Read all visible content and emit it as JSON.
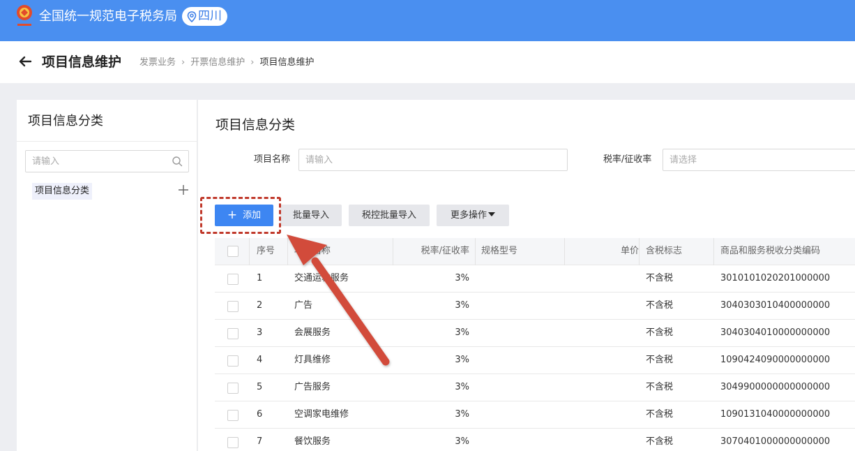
{
  "app": {
    "title": "全国统一规范电子税务局",
    "region": "四川"
  },
  "header": {
    "page_title": "项目信息维护",
    "breadcrumb": [
      "发票业务",
      "开票信息维护",
      "项目信息维护"
    ]
  },
  "left_panel": {
    "title": "项目信息分类",
    "search_placeholder": "请输入",
    "tree_node": "项目信息分类"
  },
  "main": {
    "title": "项目信息分类",
    "filters": {
      "name_label": "项目名称",
      "name_placeholder": "请输入",
      "rate_label": "税率/征收率",
      "rate_placeholder": "请选择"
    },
    "buttons": {
      "add": "添加",
      "batch_import": "批量导入",
      "taxctrl_import": "税控批量导入",
      "more": "更多操作"
    },
    "table": {
      "headers": [
        "序号",
        "项目名称",
        "税率/征收率",
        "规格型号",
        "单价",
        "含税标志",
        "商品和服务税收分类编码"
      ],
      "rows": [
        [
          "1",
          "交通运输服务",
          "3%",
          "",
          "",
          "不含税",
          "3010101020201000000"
        ],
        [
          "2",
          "广告",
          "3%",
          "",
          "",
          "不含税",
          "3040303010400000000"
        ],
        [
          "3",
          "会展服务",
          "3%",
          "",
          "",
          "不含税",
          "3040304010000000000"
        ],
        [
          "4",
          "灯具维修",
          "3%",
          "",
          "",
          "不含税",
          "1090424090000000000"
        ],
        [
          "5",
          "广告服务",
          "3%",
          "",
          "",
          "不含税",
          "3049900000000000000"
        ],
        [
          "6",
          "空调家电维修",
          "3%",
          "",
          "",
          "不含税",
          "1090131040000000000"
        ],
        [
          "7",
          "餐饮服务",
          "3%",
          "",
          "",
          "不含税",
          "3070401000000000000"
        ]
      ]
    }
  },
  "colors": {
    "brand": "#4a8ff0",
    "primary_button": "#3d86f2",
    "annotation": "#d24b3b"
  }
}
